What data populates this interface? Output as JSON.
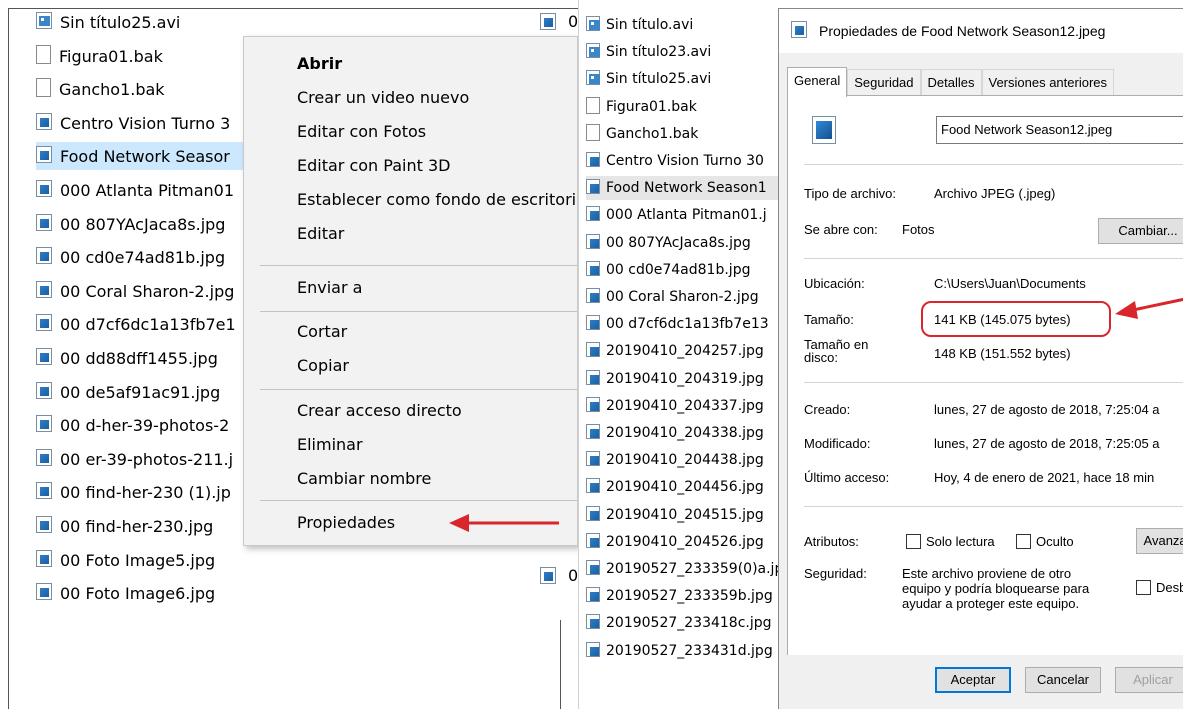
{
  "left_panel": {
    "files": [
      {
        "name": "Sin título25.avi",
        "icon": "video-file-icon"
      },
      {
        "name": "Figura01.bak",
        "icon": "blank-file-icon"
      },
      {
        "name": "Gancho1.bak",
        "icon": "blank-file-icon"
      },
      {
        "name": "Centro Vision Turno 3",
        "icon": "image-file-icon"
      },
      {
        "name": "Food Network Seasor",
        "icon": "image-file-icon",
        "selected": true
      },
      {
        "name": "000 Atlanta Pitman01",
        "icon": "image-file-icon"
      },
      {
        "name": "00 807YAcJaca8s.jpg",
        "icon": "image-file-icon"
      },
      {
        "name": "00 cd0e74ad81b.jpg",
        "icon": "image-file-icon"
      },
      {
        "name": "00 Coral Sharon-2.jpg",
        "icon": "image-file-icon"
      },
      {
        "name": "00 d7cf6dc1a13fb7e1",
        "icon": "image-file-icon"
      },
      {
        "name": "00 dd88dff1455.jpg",
        "icon": "image-file-icon"
      },
      {
        "name": "00 de5af91ac91.jpg",
        "icon": "image-file-icon"
      },
      {
        "name": "00 d-her-39-photos-2",
        "icon": "image-file-icon"
      },
      {
        "name": "00 er-39-photos-211.j",
        "icon": "image-file-icon"
      },
      {
        "name": "00 find-her-230 (1).jp",
        "icon": "image-file-icon"
      },
      {
        "name": "00 find-her-230.jpg",
        "icon": "image-file-icon"
      },
      {
        "name": "00 Foto Image5.jpg",
        "icon": "image-file-icon"
      },
      {
        "name": "00 Foto Image6.jpg",
        "icon": "image-file-icon"
      }
    ],
    "edge_top": "0",
    "edge_bottom": "0"
  },
  "context_menu": {
    "open": "Abrir",
    "create_video": "Crear un video nuevo",
    "edit_photos": "Editar con Fotos",
    "edit_paint3d": "Editar con Paint 3D",
    "set_background": "Establecer como fondo de escritorio",
    "edit": "Editar",
    "send_to": "Enviar a",
    "cut": "Cortar",
    "copy": "Copiar",
    "create_shortcut": "Crear acceso directo",
    "delete": "Eliminar",
    "rename": "Cambiar nombre",
    "properties": "Propiedades",
    "arrow_color": "#d9262c"
  },
  "middle_panel": {
    "files": [
      {
        "name": "Sin título.avi",
        "icon": "video-file-icon"
      },
      {
        "name": "Sin título23.avi",
        "icon": "video-file-icon"
      },
      {
        "name": "Sin título25.avi",
        "icon": "video-file-icon"
      },
      {
        "name": "Figura01.bak",
        "icon": "blank-file-icon"
      },
      {
        "name": "Gancho1.bak",
        "icon": "blank-file-icon"
      },
      {
        "name": "Centro Vision Turno 30",
        "icon": "image-file-icon"
      },
      {
        "name": "Food Network Season1",
        "icon": "image-file-icon",
        "selected": true
      },
      {
        "name": "000 Atlanta Pitman01.j",
        "icon": "image-file-icon"
      },
      {
        "name": "00 807YAcJaca8s.jpg",
        "icon": "image-file-icon"
      },
      {
        "name": "00 cd0e74ad81b.jpg",
        "icon": "image-file-icon"
      },
      {
        "name": "00 Coral Sharon-2.jpg",
        "icon": "image-file-icon"
      },
      {
        "name": "00 d7cf6dc1a13fb7e13",
        "icon": "image-file-icon"
      },
      {
        "name": "20190410_204257.jpg",
        "icon": "image-file-icon"
      },
      {
        "name": "20190410_204319.jpg",
        "icon": "image-file-icon"
      },
      {
        "name": "20190410_204337.jpg",
        "icon": "image-file-icon"
      },
      {
        "name": "20190410_204338.jpg",
        "icon": "image-file-icon"
      },
      {
        "name": "20190410_204438.jpg",
        "icon": "image-file-icon"
      },
      {
        "name": "20190410_204456.jpg",
        "icon": "image-file-icon"
      },
      {
        "name": "20190410_204515.jpg",
        "icon": "image-file-icon"
      },
      {
        "name": "20190410_204526.jpg",
        "icon": "image-file-icon"
      },
      {
        "name": "20190527_233359(0)a.jp",
        "icon": "image-file-icon"
      },
      {
        "name": "20190527_233359b.jpg",
        "icon": "image-file-icon"
      },
      {
        "name": "20190527_233418c.jpg",
        "icon": "image-file-icon"
      },
      {
        "name": "20190527_233431d.jpg",
        "icon": "image-file-icon"
      }
    ]
  },
  "dialog": {
    "title": "Propiedades de Food Network Season12.jpeg",
    "tabs": [
      "General",
      "Seguridad",
      "Detalles",
      "Versiones anteriores"
    ],
    "active_tab": "General",
    "filename": "Food Network Season12.jpeg",
    "file_type_label": "Tipo de archivo:",
    "file_type_value": "Archivo JPEG (.jpeg)",
    "opens_with_label": "Se abre con:",
    "opens_with_value": "Fotos",
    "change_button": "Cambiar...",
    "location_label": "Ubicación:",
    "location_value": "C:\\Users\\Juan\\Documents",
    "size_label": "Tamaño:",
    "size_value": "141 KB (145.075 bytes)",
    "size_on_disk_label": "Tamaño en disco:",
    "size_on_disk_value": "148 KB (151.552 bytes)",
    "created_label": "Creado:",
    "created_value": "lunes, 27 de agosto de 2018, 7:25:04 a",
    "modified_label": "Modificado:",
    "modified_value": "lunes, 27 de agosto de 2018, 7:25:05 a",
    "accessed_label": "Último acceso:",
    "accessed_value": "Hoy, 4 de enero de 2021, hace 18 min",
    "attributes_label": "Atributos:",
    "readonly_label": "Solo lectura",
    "hidden_label": "Oculto",
    "advanced_button": "Avanzadas...",
    "security_label": "Seguridad:",
    "security_text": "Este archivo proviene de otro equipo y podría bloquearse para ayudar a proteger este equipo.",
    "unblock_label": "Desbloquear",
    "ok_button": "Aceptar",
    "cancel_button": "Cancelar",
    "apply_button": "Aplicar",
    "highlight_color": "#d9262c"
  }
}
